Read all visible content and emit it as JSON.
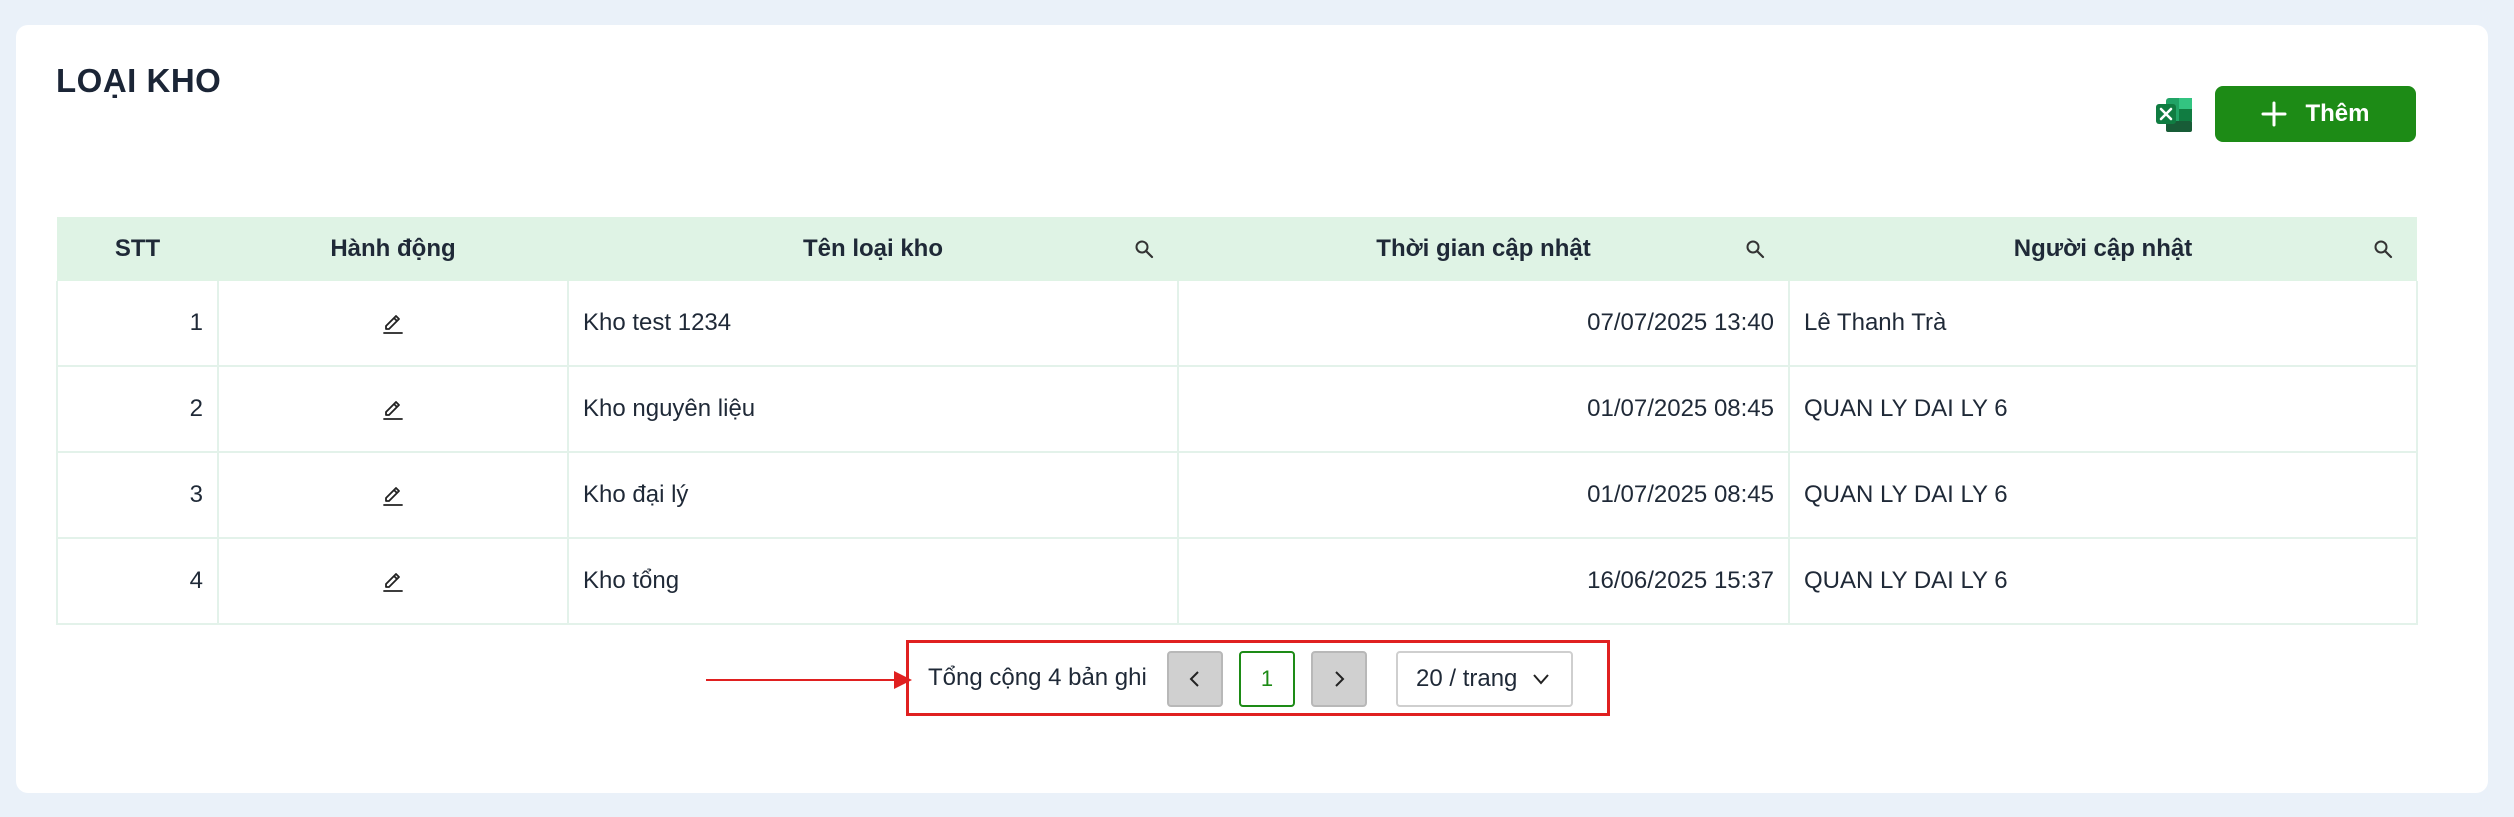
{
  "page": {
    "title": "LOẠI KHO"
  },
  "toolbar": {
    "excel_icon": "excel-icon",
    "add_label": "Thêm"
  },
  "colors": {
    "accent": "#1d8b16",
    "header_bg": "#dff3e5",
    "annotation": "#e02020"
  },
  "table": {
    "columns": [
      "STT",
      "Hành động",
      "Tên loại kho",
      "Thời gian cập nhật",
      "Người cập nhật"
    ],
    "rows": [
      {
        "stt": "1",
        "name": "Kho test 1234",
        "updated_at": "07/07/2025 13:40",
        "updated_by": "Lê Thanh Trà"
      },
      {
        "stt": "2",
        "name": "Kho nguyên liệu",
        "updated_at": "01/07/2025 08:45",
        "updated_by": "QUAN LY DAI LY 6"
      },
      {
        "stt": "3",
        "name": "Kho đại lý",
        "updated_at": "01/07/2025 08:45",
        "updated_by": "QUAN LY DAI LY 6"
      },
      {
        "stt": "4",
        "name": "Kho tổng",
        "updated_at": "16/06/2025 15:37",
        "updated_by": "QUAN LY DAI LY 6"
      }
    ]
  },
  "pagination": {
    "total_text": "Tổng cộng 4 bản ghi",
    "current_page": "1",
    "page_size": "20 / trang"
  }
}
